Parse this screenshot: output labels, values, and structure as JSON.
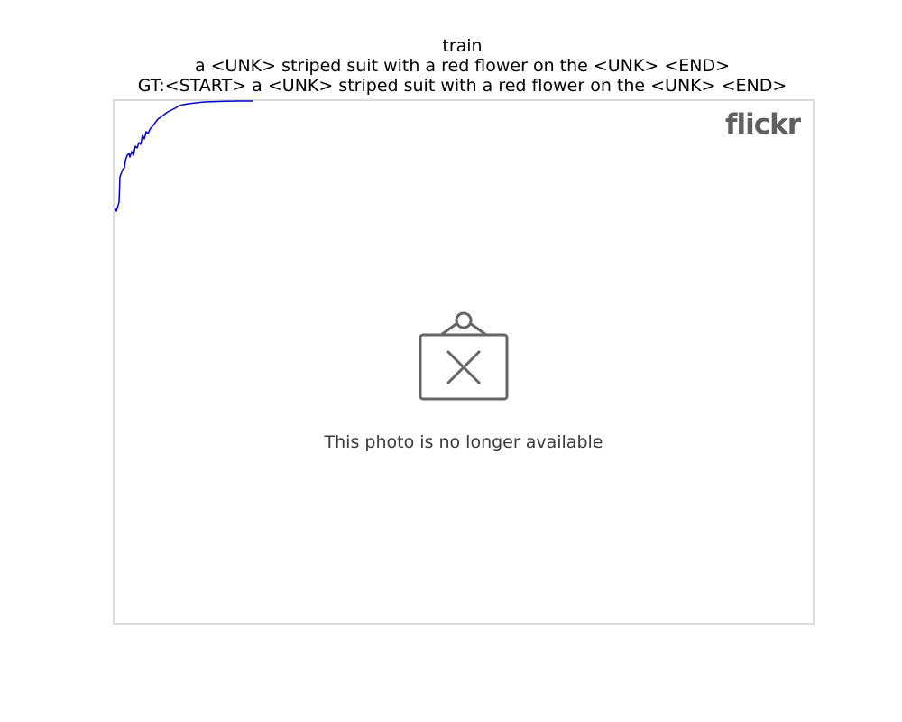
{
  "title": {
    "split": "train",
    "predicted_caption": "a <UNK> striped suit with a red flower on the <UNK> <END>",
    "ground_truth_caption": "GT:<START> a <UNK> striped suit with a red flower on the <UNK> <END>"
  },
  "image": {
    "logo_text": "flickr",
    "placeholder_icon": "broken-photo-icon",
    "placeholder_message": "This photo is no longer available"
  },
  "colors": {
    "curve": "#0000cc",
    "frame_border": "#dcdcdc",
    "logo": "#5f5f5f",
    "icon": "#666666"
  }
}
